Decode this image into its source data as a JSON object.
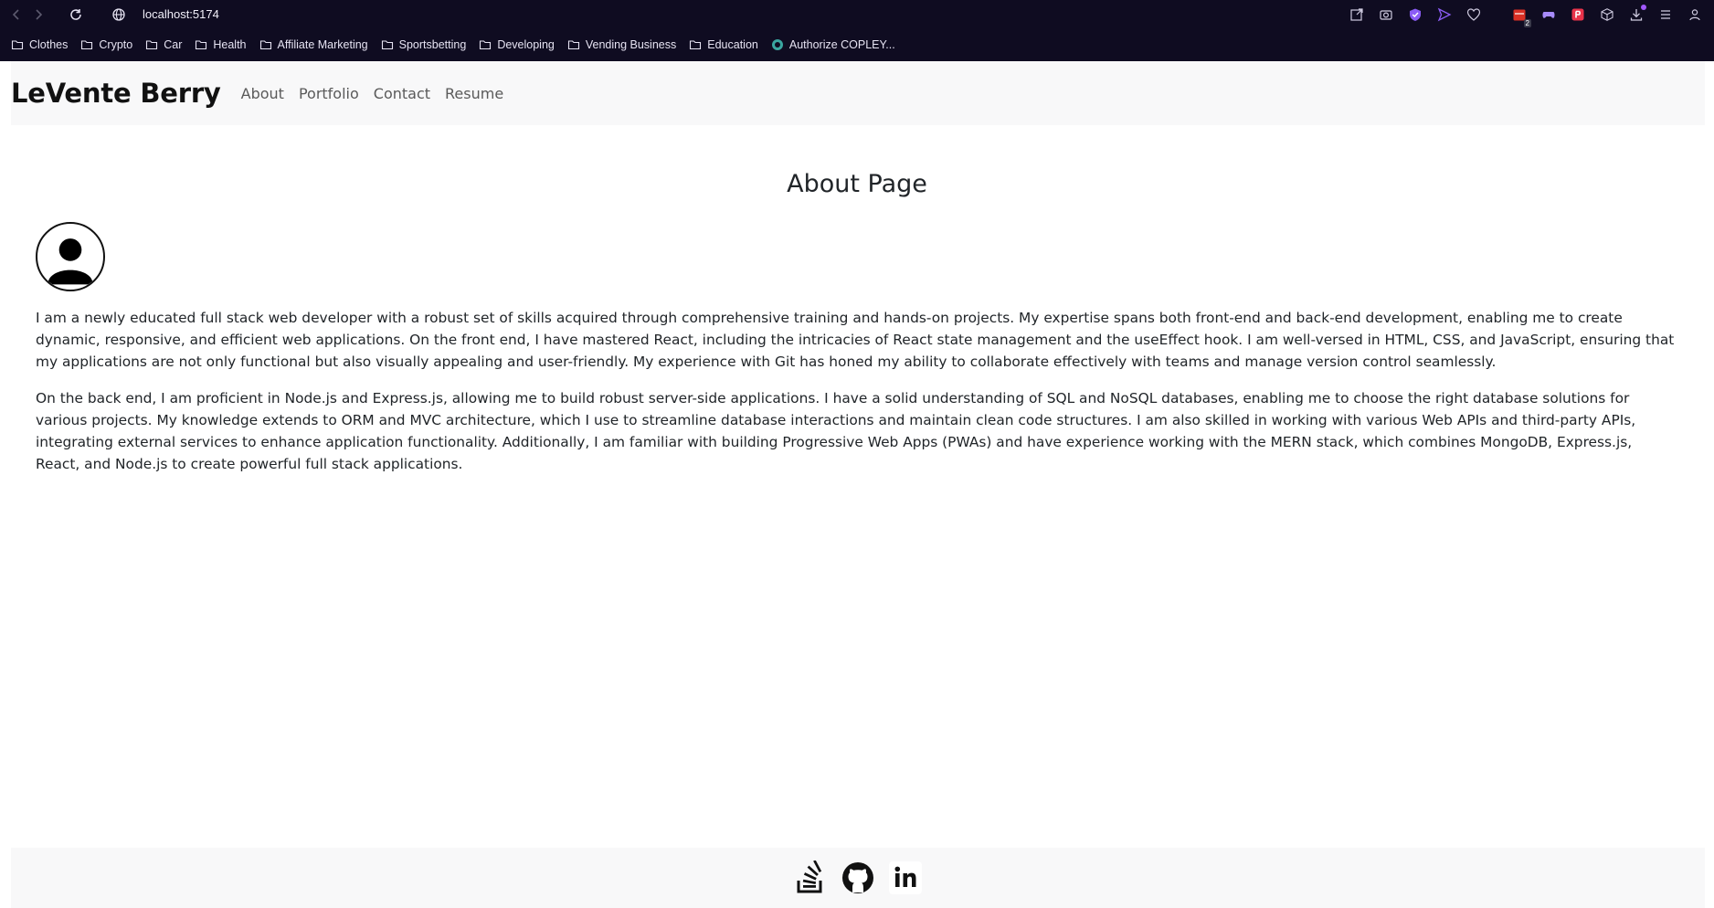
{
  "browser": {
    "url": "localhost:5174",
    "bookmarks": [
      {
        "label": "Clothes",
        "icon": "folder-icon"
      },
      {
        "label": "Crypto",
        "icon": "folder-icon"
      },
      {
        "label": "Car",
        "icon": "folder-icon"
      },
      {
        "label": "Health",
        "icon": "folder-icon"
      },
      {
        "label": "Affiliate Marketing",
        "icon": "folder-icon"
      },
      {
        "label": "Sportsbetting",
        "icon": "folder-icon"
      },
      {
        "label": "Developing",
        "icon": "folder-icon"
      },
      {
        "label": "Vending Business",
        "icon": "folder-icon"
      },
      {
        "label": "Education",
        "icon": "folder-icon"
      },
      {
        "label": "Authorize COPLEY...",
        "icon": "site-favicon-icon"
      }
    ],
    "extension_badge": "2"
  },
  "header": {
    "brand": "LeVente Berry",
    "nav": [
      "About",
      "Portfolio",
      "Contact",
      "Resume"
    ]
  },
  "main": {
    "title": "About Page",
    "paragraphs": [
      "I am a newly educated full stack web developer with a robust set of skills acquired through comprehensive training and hands-on projects. My expertise spans both front-end and back-end development, enabling me to create dynamic, responsive, and efficient web applications. On the front end, I have mastered React, including the intricacies of React state management and the useEffect hook. I am well-versed in HTML, CSS, and JavaScript, ensuring that my applications are not only functional but also visually appealing and user-friendly. My experience with Git has honed my ability to collaborate effectively with teams and manage version control seamlessly.",
      "On the back end, I am proficient in Node.js and Express.js, allowing me to build robust server-side applications. I have a solid understanding of SQL and NoSQL databases, enabling me to choose the right database solutions for various projects. My knowledge extends to ORM and MVC architecture, which I use to streamline database interactions and maintain clean code structures. I am also skilled in working with various Web APIs and third-party APIs, integrating external services to enhance application functionality. Additionally, I am familiar with building Progressive Web Apps (PWAs) and have experience working with the MERN stack, which combines MongoDB, Express.js, React, and Node.js to create powerful full stack applications."
    ]
  },
  "footer": {
    "social_icons": [
      "stackoverflow-icon",
      "github-icon",
      "linkedin-icon"
    ]
  },
  "colors": {
    "chrome_bg": "#0f0c21",
    "header_bg": "#f8f8f9",
    "text": "#212529"
  }
}
